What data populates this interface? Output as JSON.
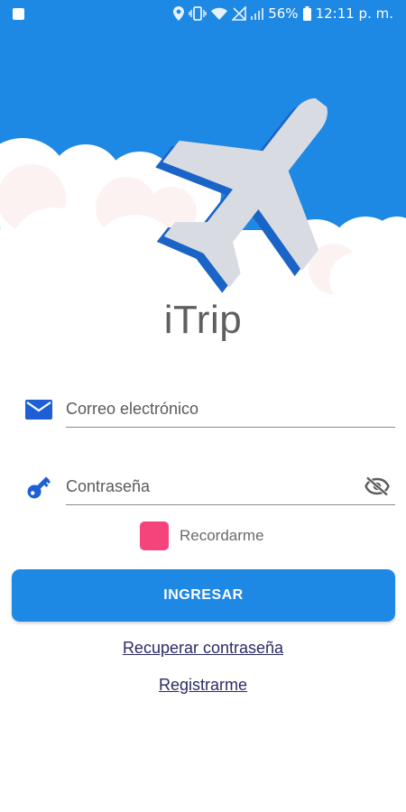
{
  "status_bar": {
    "battery_percent": "56%",
    "time": "12:11 p. m."
  },
  "app": {
    "title": "iTrip"
  },
  "form": {
    "email_placeholder": "Correo electrónico",
    "password_placeholder": "Contraseña",
    "remember_label": "Recordarme",
    "remember_checked": true,
    "login_label": "INGRESAR"
  },
  "links": {
    "recover": "Recuperar contraseña",
    "register": "Registrarme"
  },
  "icons": {
    "email": "envelope-icon",
    "password": "key-icon",
    "toggle_visibility": "eye-off-icon"
  },
  "colors": {
    "primary": "#1e88e5",
    "checkbox": "#f5447c",
    "title": "#5f5f5f",
    "link": "#2c2a66"
  }
}
